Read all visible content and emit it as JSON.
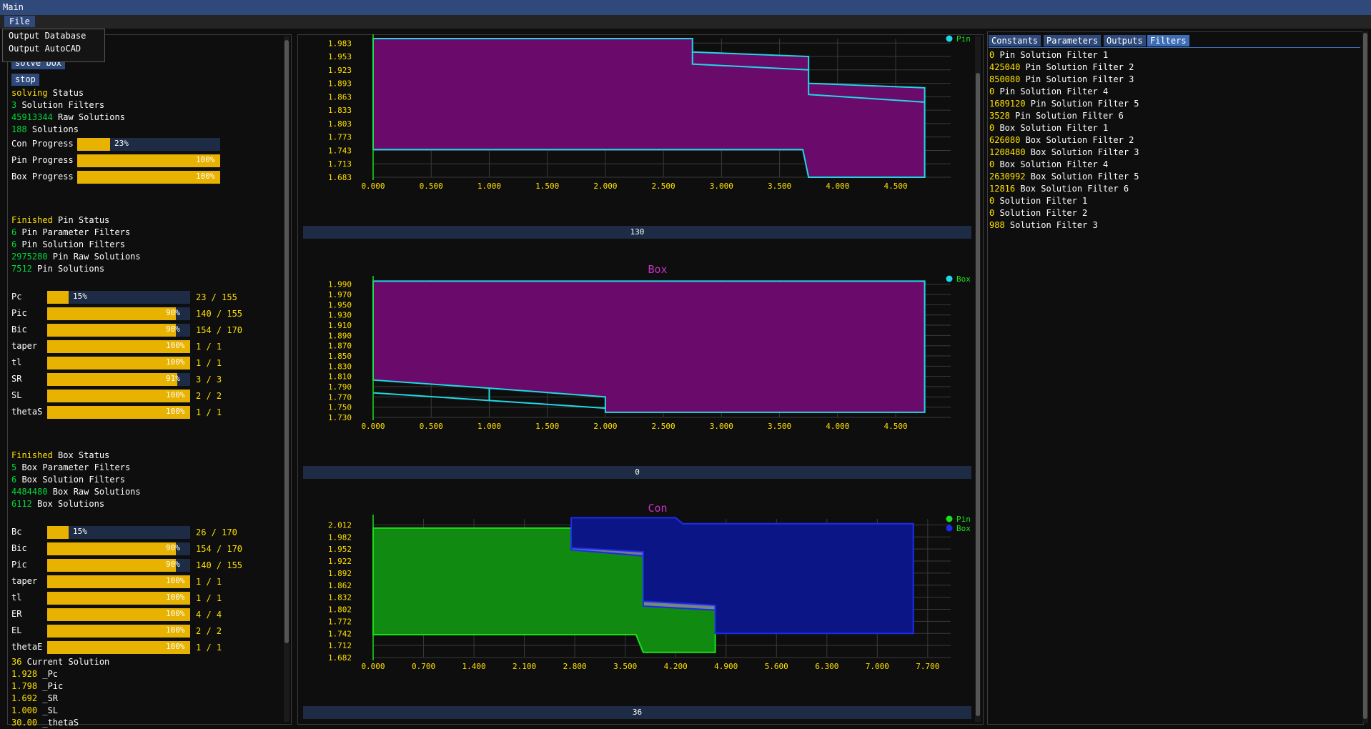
{
  "window": {
    "title": "Main"
  },
  "menu": {
    "file": "File",
    "items": [
      "Output Database",
      "Output AutoCAD"
    ]
  },
  "left": {
    "solve_button": "solve box",
    "stop_button": "stop",
    "status": [
      {
        "v": "solving",
        "vc": "y",
        "t": " Status"
      },
      {
        "v": "3",
        "vc": "g",
        "t": " Solution Filters"
      },
      {
        "v": "45913344",
        "vc": "g",
        "t": " Raw Solutions"
      },
      {
        "v": "188",
        "vc": "g",
        "t": " Solutions"
      }
    ],
    "progress": [
      {
        "label": "Con Progress",
        "fraction": 0.23,
        "text": "23%"
      },
      {
        "label": "Pin Progress",
        "fraction": 1.0,
        "text": "100%"
      },
      {
        "label": "Box Progress",
        "fraction": 1.0,
        "text": "100%"
      }
    ],
    "pin_status": [
      {
        "v": "Finished",
        "vc": "y",
        "t": " Pin Status"
      },
      {
        "v": "6",
        "vc": "g",
        "t": " Pin Parameter Filters"
      },
      {
        "v": "6",
        "vc": "g",
        "t": " Pin Solution Filters"
      },
      {
        "v": "2975280",
        "vc": "g",
        "t": " Pin Raw Solutions"
      },
      {
        "v": "7512",
        "vc": "g",
        "t": " Pin Solutions"
      }
    ],
    "pin_params": [
      {
        "label": "Pc",
        "fraction": 0.15,
        "text": "15%",
        "count": "23 / 155"
      },
      {
        "label": "Pic",
        "fraction": 0.9,
        "text": "90%",
        "count": "140 / 155"
      },
      {
        "label": "Bic",
        "fraction": 0.9,
        "text": "90%",
        "count": "154 / 170"
      },
      {
        "label": "taper",
        "fraction": 1.0,
        "text": "100%",
        "count": "1 / 1"
      },
      {
        "label": "tl",
        "fraction": 1.0,
        "text": "100%",
        "count": "1 / 1"
      },
      {
        "label": "SR",
        "fraction": 0.91,
        "text": "91%",
        "count": "3 / 3"
      },
      {
        "label": "SL",
        "fraction": 1.0,
        "text": "100%",
        "count": "2 / 2"
      },
      {
        "label": "thetaS",
        "fraction": 1.0,
        "text": "100%",
        "count": "1 / 1"
      }
    ],
    "box_status": [
      {
        "v": "Finished",
        "vc": "y",
        "t": " Box Status"
      },
      {
        "v": "5",
        "vc": "g",
        "t": " Box Parameter Filters"
      },
      {
        "v": "6",
        "vc": "g",
        "t": " Box Solution Filters"
      },
      {
        "v": "4484480",
        "vc": "g",
        "t": " Box Raw Solutions"
      },
      {
        "v": "6112",
        "vc": "g",
        "t": " Box Solutions"
      }
    ],
    "box_params": [
      {
        "label": "Bc",
        "fraction": 0.15,
        "text": "15%",
        "count": "26 / 170"
      },
      {
        "label": "Bic",
        "fraction": 0.9,
        "text": "90%",
        "count": "154 / 170"
      },
      {
        "label": "Pic",
        "fraction": 0.9,
        "text": "90%",
        "count": "140 / 155"
      },
      {
        "label": "taper",
        "fraction": 1.0,
        "text": "100%",
        "count": "1 / 1"
      },
      {
        "label": "tl",
        "fraction": 1.0,
        "text": "100%",
        "count": "1 / 1"
      },
      {
        "label": "ER",
        "fraction": 1.0,
        "text": "100%",
        "count": "4 / 4"
      },
      {
        "label": "EL",
        "fraction": 1.0,
        "text": "100%",
        "count": "2 / 2"
      },
      {
        "label": "thetaE",
        "fraction": 1.0,
        "text": "100%",
        "count": "1 / 1"
      }
    ],
    "current": [
      {
        "v": "36",
        "vc": "y",
        "t": " Current Solution"
      },
      {
        "v": "1.928",
        "vc": "y",
        "t": " _Pc"
      },
      {
        "v": "1.798",
        "vc": "y",
        "t": " _Pic"
      },
      {
        "v": "1.692",
        "vc": "y",
        "t": " _SR"
      },
      {
        "v": "1.000",
        "vc": "y",
        "t": " _SL"
      },
      {
        "v": "30.00",
        "vc": "y",
        "t": " _thetaS"
      }
    ]
  },
  "right": {
    "tabs": [
      "Constants",
      "Parameters",
      "Outputs",
      "Filters"
    ],
    "filters": [
      {
        "v": "0",
        "t": " Pin Solution Filter 1"
      },
      {
        "v": "425040",
        "t": " Pin Solution Filter 2"
      },
      {
        "v": "850080",
        "t": " Pin Solution Filter 3"
      },
      {
        "v": "0",
        "t": " Pin Solution Filter 4"
      },
      {
        "v": "1689120",
        "t": " Pin Solution Filter 5"
      },
      {
        "v": "3528",
        "t": " Pin Solution Filter 6"
      },
      {
        "v": "0",
        "t": " Box Solution Filter 1"
      },
      {
        "v": "626080",
        "t": " Box Solution Filter 2"
      },
      {
        "v": "1208480",
        "t": " Box Solution Filter 3"
      },
      {
        "v": "0",
        "t": " Box Solution Filter 4"
      },
      {
        "v": "2630992",
        "t": " Box Solution Filter 5"
      },
      {
        "v": "12816",
        "t": " Box Solution Filter 6"
      },
      {
        "v": "0",
        "t": " Solution Filter 1"
      },
      {
        "v": "0",
        "t": " Solution Filter 2"
      },
      {
        "v": "988",
        "t": " Solution Filter 3"
      }
    ]
  },
  "sliders": {
    "pin": "130",
    "box": "0",
    "con": "36"
  },
  "colors": {
    "accent": "#2f4a7a",
    "bar": "#e8b200",
    "value_yellow": "#ffe000",
    "value_green": "#00d83a",
    "magenta": "#6a0a6a",
    "cyan": "#1fd8e6",
    "pin_green": "#108a10",
    "box_blue": "#0c1586"
  },
  "chart_data": [
    {
      "type": "area",
      "title": "",
      "legend": [
        "Pin"
      ],
      "legend_placement": "top-right",
      "xlim": [
        0.0,
        4.9
      ],
      "ylim": [
        1.683,
        1.993
      ],
      "x_ticks": [
        "0.000",
        "0.500",
        "1.000",
        "1.500",
        "2.000",
        "2.500",
        "3.000",
        "3.500",
        "4.000",
        "4.500"
      ],
      "y_ticks": [
        "1.983",
        "1.953",
        "1.923",
        "1.893",
        "1.863",
        "1.833",
        "1.803",
        "1.773",
        "1.743",
        "1.713",
        "1.683"
      ],
      "shapes": [
        {
          "fill": "#6a0a6a",
          "stroke": "#1fd8e6",
          "points": [
            [
              0,
              1.993
            ],
            [
              2.75,
              1.993
            ],
            [
              2.75,
              1.963
            ],
            [
              3.75,
              1.953
            ],
            [
              3.75,
              1.893
            ],
            [
              4.75,
              1.883
            ],
            [
              4.75,
              1.683
            ],
            [
              3.75,
              1.683
            ],
            [
              3.7,
              1.745
            ],
            [
              0,
              1.745
            ]
          ]
        },
        {
          "fill": "none",
          "stroke": "#1fd8e6",
          "points": [
            [
              2.75,
              1.963
            ],
            [
              2.75,
              1.936
            ],
            [
              3.75,
              1.923
            ]
          ]
        },
        {
          "fill": "none",
          "stroke": "#1fd8e6",
          "points": [
            [
              3.75,
              1.893
            ],
            [
              3.75,
              1.868
            ],
            [
              4.75,
              1.851
            ]
          ]
        }
      ]
    },
    {
      "type": "area",
      "title": "Box",
      "legend": [
        "Box"
      ],
      "legend_placement": "top-right",
      "xlim": [
        0.0,
        4.9
      ],
      "ylim": [
        1.73,
        1.998
      ],
      "x_ticks": [
        "0.000",
        "0.500",
        "1.000",
        "1.500",
        "2.000",
        "2.500",
        "3.000",
        "3.500",
        "4.000",
        "4.500"
      ],
      "y_ticks": [
        "1.990",
        "1.970",
        "1.950",
        "1.930",
        "1.910",
        "1.890",
        "1.870",
        "1.850",
        "1.830",
        "1.810",
        "1.790",
        "1.770",
        "1.750",
        "1.730"
      ],
      "shapes": [
        {
          "fill": "#6a0a6a",
          "stroke": "#1fd8e6",
          "points": [
            [
              0,
              1.996
            ],
            [
              4.75,
              1.996
            ],
            [
              4.75,
              1.74
            ],
            [
              2.0,
              1.74
            ],
            [
              2.0,
              1.77
            ],
            [
              1.0,
              1.787
            ],
            [
              0,
              1.803
            ]
          ]
        },
        {
          "fill": "none",
          "stroke": "#1fd8e6",
          "points": [
            [
              0,
              1.778
            ],
            [
              1.0,
              1.763
            ],
            [
              2.0,
              1.748
            ]
          ]
        },
        {
          "fill": "none",
          "stroke": "#1fd8e6",
          "points": [
            [
              1.0,
              1.787
            ],
            [
              1.0,
              1.763
            ]
          ]
        }
      ]
    },
    {
      "type": "area",
      "title": "Con",
      "legend": [
        "Pin",
        "Box"
      ],
      "legend_placement": "top-right",
      "xlim": [
        0.0,
        7.9
      ],
      "ylim": [
        1.682,
        2.027
      ],
      "x_ticks": [
        "0.000",
        "0.700",
        "1.400",
        "2.100",
        "2.800",
        "3.500",
        "4.200",
        "4.900",
        "5.600",
        "6.300",
        "7.000",
        "7.700"
      ],
      "y_ticks": [
        "2.012",
        "1.982",
        "1.952",
        "1.922",
        "1.892",
        "1.862",
        "1.832",
        "1.802",
        "1.772",
        "1.742",
        "1.712",
        "1.682"
      ],
      "shapes": [
        {
          "fill": "#108a10",
          "stroke": "#19e019",
          "points": [
            [
              0,
              2.004
            ],
            [
              2.75,
              2.004
            ],
            [
              2.75,
              1.955
            ],
            [
              3.75,
              1.945
            ],
            [
              3.75,
              1.822
            ],
            [
              4.75,
              1.812
            ],
            [
              4.75,
              1.695
            ],
            [
              3.75,
              1.695
            ],
            [
              3.65,
              1.739
            ],
            [
              0,
              1.739
            ]
          ]
        },
        {
          "fill": "#0c1586",
          "stroke": "#1b2cf0",
          "points": [
            [
              2.75,
              2.03
            ],
            [
              4.2,
              2.03
            ],
            [
              4.3,
              2.015
            ],
            [
              7.5,
              2.015
            ],
            [
              7.5,
              1.742
            ],
            [
              4.75,
              1.742
            ],
            [
              4.75,
              1.808
            ],
            [
              3.75,
              1.82
            ],
            [
              3.75,
              1.935
            ],
            [
              2.75,
              1.95
            ]
          ]
        },
        {
          "fill": "#888888",
          "stroke": "#1b2cf0",
          "points": [
            [
              2.75,
              1.955
            ],
            [
              3.75,
              1.945
            ],
            [
              3.75,
              1.935
            ],
            [
              2.75,
              1.95
            ]
          ]
        },
        {
          "fill": "#888888",
          "stroke": "#1b2cf0",
          "points": [
            [
              3.75,
              1.822
            ],
            [
              4.75,
              1.812
            ],
            [
              4.75,
              1.8
            ],
            [
              3.75,
              1.81
            ]
          ]
        }
      ]
    }
  ]
}
